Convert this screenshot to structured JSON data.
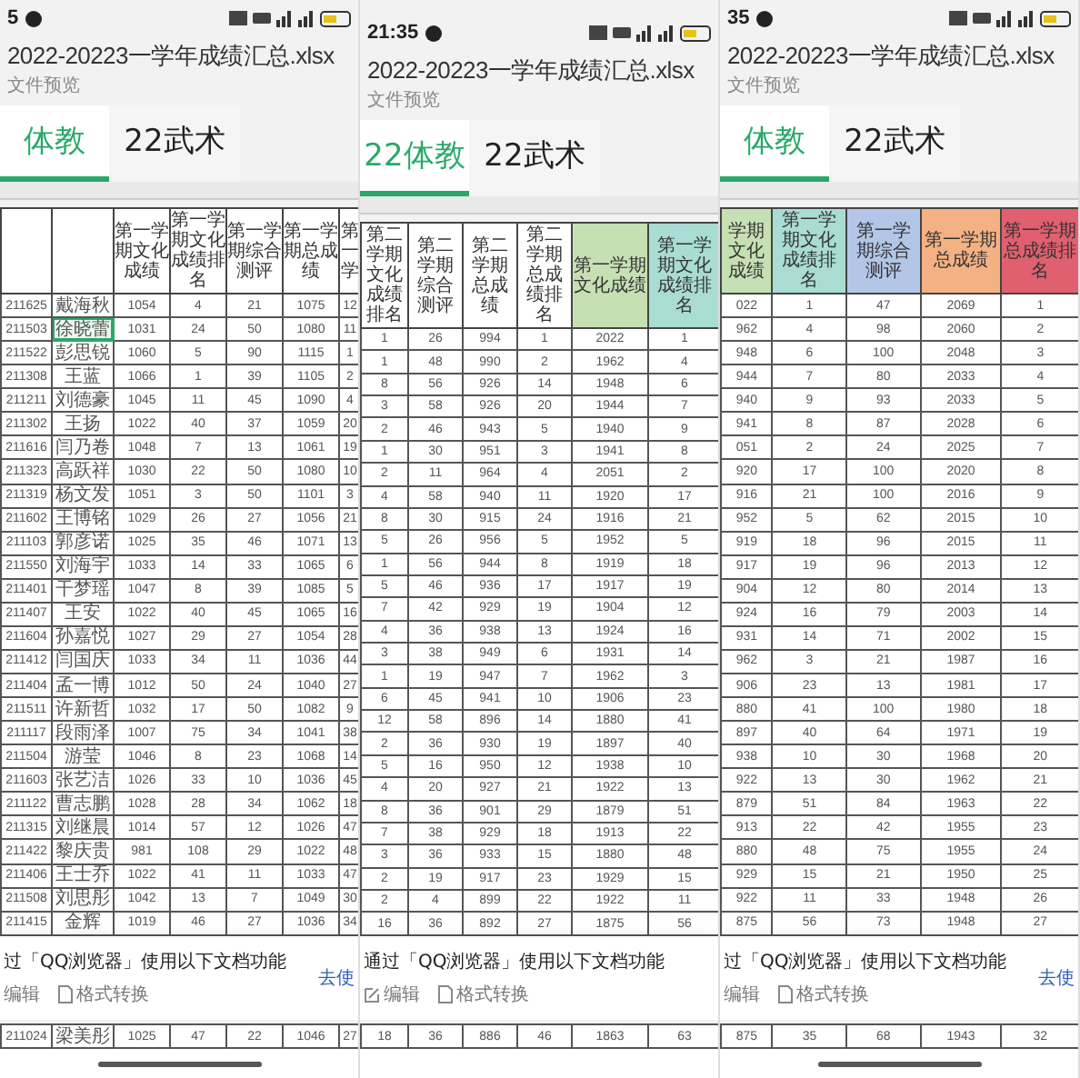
{
  "panels": [
    {
      "status_time": "5",
      "title": "2022-20223一学年成绩汇总.xlsx",
      "subtitle": "文件预览",
      "home_indicator": true,
      "tabs": [
        {
          "label": "体教",
          "selected": true
        },
        {
          "label": "22武术",
          "selected": false
        }
      ],
      "columns": [
        {},
        {},
        {
          "label": "第一学期文化成绩"
        },
        {
          "label": "第一学期文化成绩排名"
        },
        {
          "label": "第一学期综合测评"
        },
        {
          "label": "第一学期总成绩"
        },
        {
          "label": "第一学"
        }
      ],
      "rows": [
        {
          "selected": false,
          "cells": [
            "211625",
            "戴海秋",
            "1054",
            "4",
            "21",
            "1075",
            "12"
          ]
        },
        {
          "selected": true,
          "cells": [
            "211503",
            "徐晓蕾",
            "1031",
            "24",
            "50",
            "1080",
            "11"
          ]
        },
        {
          "selected": false,
          "cells": [
            "211522",
            "彭思锐",
            "1060",
            "5",
            "90",
            "1115",
            "1"
          ]
        },
        {
          "selected": false,
          "cells": [
            "211308",
            "王蓝",
            "1066",
            "1",
            "39",
            "1105",
            "2"
          ]
        },
        {
          "selected": false,
          "cells": [
            "211211",
            "刘德豪",
            "1045",
            "11",
            "45",
            "1090",
            "4"
          ]
        },
        {
          "selected": false,
          "cells": [
            "211302",
            "王扬",
            "1022",
            "40",
            "37",
            "1059",
            "20"
          ]
        },
        {
          "selected": false,
          "cells": [
            "211616",
            "闫乃卷",
            "1048",
            "7",
            "13",
            "1061",
            "19"
          ]
        },
        {
          "selected": false,
          "cells": [
            "211323",
            "高跃祥",
            "1030",
            "22",
            "50",
            "1080",
            "10"
          ]
        },
        {
          "selected": false,
          "cells": [
            "211319",
            "杨文发",
            "1051",
            "3",
            "50",
            "1101",
            "3"
          ]
        },
        {
          "selected": false,
          "cells": [
            "211602",
            "王博铭",
            "1029",
            "26",
            "27",
            "1056",
            "21"
          ]
        },
        {
          "selected": false,
          "cells": [
            "211103",
            "郭彦诺",
            "1025",
            "35",
            "46",
            "1071",
            "13"
          ]
        },
        {
          "selected": false,
          "cells": [
            "211550",
            "刘海宇",
            "1033",
            "14",
            "33",
            "1065",
            "6"
          ]
        },
        {
          "selected": false,
          "cells": [
            "211401",
            "干梦瑶",
            "1047",
            "8",
            "39",
            "1085",
            "5"
          ]
        },
        {
          "selected": false,
          "cells": [
            "211407",
            "王安",
            "1022",
            "40",
            "45",
            "1065",
            "16"
          ]
        },
        {
          "selected": false,
          "cells": [
            "211604",
            "孙嘉悦",
            "1027",
            "29",
            "27",
            "1054",
            "28"
          ]
        },
        {
          "selected": false,
          "cells": [
            "211412",
            "闫国庆",
            "1033",
            "34",
            "11",
            "1036",
            "44"
          ]
        },
        {
          "selected": false,
          "cells": [
            "211404",
            "孟一博",
            "1012",
            "50",
            "24",
            "1040",
            "27"
          ]
        },
        {
          "selected": false,
          "cells": [
            "211511",
            "许新哲",
            "1032",
            "17",
            "50",
            "1082",
            "9"
          ]
        },
        {
          "selected": false,
          "cells": [
            "211117",
            "段雨泽",
            "1007",
            "75",
            "34",
            "1041",
            "38"
          ]
        },
        {
          "selected": false,
          "cells": [
            "211504",
            "游莹",
            "1046",
            "8",
            "23",
            "1068",
            "14"
          ]
        },
        {
          "selected": false,
          "cells": [
            "211603",
            "张艺洁",
            "1026",
            "33",
            "10",
            "1036",
            "45"
          ]
        },
        {
          "selected": false,
          "cells": [
            "211122",
            "曹志鹏",
            "1028",
            "28",
            "34",
            "1062",
            "18"
          ]
        },
        {
          "selected": false,
          "cells": [
            "211315",
            "刘继晨",
            "1014",
            "57",
            "12",
            "1026",
            "47"
          ]
        },
        {
          "selected": false,
          "cells": [
            "211422",
            "黎庆贵",
            "981",
            "108",
            "29",
            "1022",
            "48"
          ]
        },
        {
          "selected": false,
          "cells": [
            "211406",
            "王士乔",
            "1022",
            "41",
            "11",
            "1033",
            "47"
          ]
        },
        {
          "selected": false,
          "cells": [
            "211508",
            "刘思彤",
            "1042",
            "13",
            "7",
            "1049",
            "30"
          ]
        },
        {
          "selected": false,
          "cells": [
            "211415",
            "金辉",
            "1019",
            "46",
            "27",
            "1036",
            "34"
          ]
        }
      ],
      "banner": {
        "text": "过「QQ浏览器」使用以下文档功能",
        "actions": [
          {
            "kind": "text",
            "label": "编辑"
          },
          {
            "kind": "file",
            "label": "格式转换"
          }
        ],
        "link": "去使"
      },
      "peek_row": {
        "cells": [
          "211024",
          "梁美彤",
          "1025",
          "47",
          "22",
          "1046",
          "27"
        ]
      }
    },
    {
      "status_time": "21:35",
      "title": "2022-20223一学年成绩汇总.xlsx",
      "subtitle": "文件预览",
      "home_indicator": false,
      "tabs": [
        {
          "label": "22体教",
          "selected": true
        },
        {
          "label": "22武术",
          "selected": false
        }
      ],
      "columns": [
        {
          "label": "第二学期文化成绩排名"
        },
        {
          "label": "第二学期综合测评"
        },
        {
          "label": "第二学期总成绩"
        },
        {
          "label": "第二学期总成绩排名"
        },
        {
          "label": "第一学期文化成绩",
          "color": "#c6e0b4"
        },
        {
          "label": "第一学期文化成绩排名",
          "color": "#a9dcd3"
        }
      ],
      "rows": [
        {
          "cells": [
            "1",
            "26",
            "994",
            "1",
            "2022",
            "1"
          ]
        },
        {
          "cells": [
            "1",
            "48",
            "990",
            "2",
            "1962",
            "4"
          ]
        },
        {
          "cells": [
            "8",
            "56",
            "926",
            "14",
            "1948",
            "6"
          ]
        },
        {
          "cells": [
            "3",
            "58",
            "926",
            "20",
            "1944",
            "7"
          ]
        },
        {
          "cells": [
            "2",
            "46",
            "943",
            "5",
            "1940",
            "9"
          ]
        },
        {
          "cells": [
            "1",
            "30",
            "951",
            "3",
            "1941",
            "8"
          ]
        },
        {
          "cells": [
            "2",
            "11",
            "964",
            "4",
            "2051",
            "2"
          ]
        },
        {
          "cells": [
            "4",
            "58",
            "940",
            "11",
            "1920",
            "17"
          ]
        },
        {
          "cells": [
            "8",
            "30",
            "915",
            "24",
            "1916",
            "21"
          ]
        },
        {
          "cells": [
            "5",
            "26",
            "956",
            "5",
            "1952",
            "5"
          ]
        },
        {
          "cells": [
            "1",
            "56",
            "944",
            "8",
            "1919",
            "18"
          ]
        },
        {
          "cells": [
            "5",
            "46",
            "936",
            "17",
            "1917",
            "19"
          ]
        },
        {
          "cells": [
            "7",
            "42",
            "929",
            "19",
            "1904",
            "12"
          ]
        },
        {
          "cells": [
            "4",
            "36",
            "938",
            "13",
            "1924",
            "16"
          ]
        },
        {
          "cells": [
            "3",
            "38",
            "949",
            "6",
            "1931",
            "14"
          ]
        },
        {
          "cells": [
            "1",
            "19",
            "947",
            "7",
            "1962",
            "3"
          ]
        },
        {
          "cells": [
            "6",
            "45",
            "941",
            "10",
            "1906",
            "23"
          ]
        },
        {
          "cells": [
            "12",
            "58",
            "896",
            "14",
            "1880",
            "41"
          ]
        },
        {
          "cells": [
            "2",
            "36",
            "930",
            "19",
            "1897",
            "40"
          ]
        },
        {
          "cells": [
            "5",
            "16",
            "950",
            "12",
            "1938",
            "10"
          ]
        },
        {
          "cells": [
            "4",
            "20",
            "927",
            "21",
            "1922",
            "13"
          ]
        },
        {
          "cells": [
            "8",
            "36",
            "901",
            "29",
            "1879",
            "51"
          ]
        },
        {
          "cells": [
            "7",
            "38",
            "929",
            "18",
            "1913",
            "22"
          ]
        },
        {
          "cells": [
            "3",
            "36",
            "933",
            "15",
            "1880",
            "48"
          ]
        },
        {
          "cells": [
            "2",
            "19",
            "917",
            "23",
            "1929",
            "15"
          ]
        },
        {
          "cells": [
            "2",
            "4",
            "899",
            "22",
            "1922",
            "11"
          ]
        },
        {
          "cells": [
            "16",
            "36",
            "892",
            "27",
            "1875",
            "56"
          ]
        }
      ],
      "banner": {
        "text": "通过「QQ浏览器」使用以下文档功能",
        "actions": [
          {
            "kind": "edit",
            "label": "编辑"
          },
          {
            "kind": "file",
            "label": "格式转换"
          }
        ]
      },
      "peek_row": {
        "cells": [
          "18",
          "36",
          "886",
          "46",
          "1863",
          "63"
        ]
      }
    },
    {
      "status_time": "35",
      "title": "2022-20223一学年成绩汇总.xlsx",
      "subtitle": "文件预览",
      "home_indicator": true,
      "tabs": [
        {
          "label": "体教",
          "selected": true
        },
        {
          "label": "22武术",
          "selected": false
        }
      ],
      "columns": [
        {
          "label": "学期文化成绩",
          "color": "#c6e0b4"
        },
        {
          "label": "第一学期文化成绩排名",
          "color": "#a9dcd3"
        },
        {
          "label": "第一学期综合测评",
          "color": "#b4c6e7"
        },
        {
          "label": "第一学期总成绩",
          "color": "#f4b183"
        },
        {
          "label": "第一学期总成绩排名",
          "color": "#e06070"
        }
      ],
      "rows": [
        {
          "cells": [
            "022",
            "1",
            "47",
            "2069",
            "1"
          ]
        },
        {
          "cells": [
            "962",
            "4",
            "98",
            "2060",
            "2"
          ]
        },
        {
          "cells": [
            "948",
            "6",
            "100",
            "2048",
            "3"
          ]
        },
        {
          "cells": [
            "944",
            "7",
            "80",
            "2033",
            "4"
          ]
        },
        {
          "cells": [
            "940",
            "9",
            "93",
            "2033",
            "5"
          ]
        },
        {
          "cells": [
            "941",
            "8",
            "87",
            "2028",
            "6"
          ]
        },
        {
          "cells": [
            "051",
            "2",
            "24",
            "2025",
            "7"
          ]
        },
        {
          "cells": [
            "920",
            "17",
            "100",
            "2020",
            "8"
          ]
        },
        {
          "cells": [
            "916",
            "21",
            "100",
            "2016",
            "9"
          ]
        },
        {
          "cells": [
            "952",
            "5",
            "62",
            "2015",
            "10"
          ]
        },
        {
          "cells": [
            "919",
            "18",
            "96",
            "2015",
            "11"
          ]
        },
        {
          "cells": [
            "917",
            "19",
            "96",
            "2013",
            "12"
          ]
        },
        {
          "cells": [
            "904",
            "12",
            "80",
            "2014",
            "13"
          ]
        },
        {
          "cells": [
            "924",
            "16",
            "79",
            "2003",
            "14"
          ]
        },
        {
          "cells": [
            "931",
            "14",
            "71",
            "2002",
            "15"
          ]
        },
        {
          "cells": [
            "962",
            "3",
            "21",
            "1987",
            "16"
          ]
        },
        {
          "cells": [
            "906",
            "23",
            "13",
            "1981",
            "17"
          ]
        },
        {
          "cells": [
            "880",
            "41",
            "100",
            "1980",
            "18"
          ]
        },
        {
          "cells": [
            "897",
            "40",
            "64",
            "1971",
            "19"
          ]
        },
        {
          "cells": [
            "938",
            "10",
            "30",
            "1968",
            "20"
          ]
        },
        {
          "cells": [
            "922",
            "13",
            "30",
            "1962",
            "21"
          ]
        },
        {
          "cells": [
            "879",
            "51",
            "84",
            "1963",
            "22"
          ]
        },
        {
          "cells": [
            "913",
            "22",
            "42",
            "1955",
            "23"
          ]
        },
        {
          "cells": [
            "880",
            "48",
            "75",
            "1955",
            "24"
          ]
        },
        {
          "cells": [
            "929",
            "15",
            "21",
            "1950",
            "25"
          ]
        },
        {
          "cells": [
            "922",
            "11",
            "33",
            "1948",
            "26"
          ]
        },
        {
          "cells": [
            "875",
            "56",
            "73",
            "1948",
            "27"
          ]
        }
      ],
      "banner": {
        "text": "过「QQ浏览器」使用以下文档功能",
        "actions": [
          {
            "kind": "text",
            "label": "编辑"
          },
          {
            "kind": "file",
            "label": "格式转换"
          }
        ],
        "link": "去使"
      },
      "peek_row": {
        "cells": [
          "875",
          "35",
          "68",
          "1943",
          "32"
        ]
      }
    }
  ]
}
